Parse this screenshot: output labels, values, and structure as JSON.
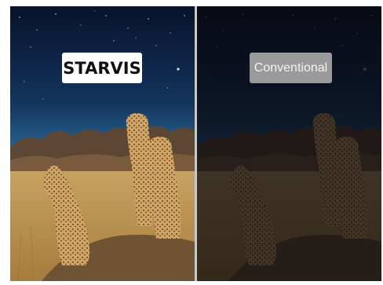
{
  "comparison": {
    "left_label": "STARVIS",
    "right_label": "Conventional"
  },
  "colors": {
    "sky_top": "#0b1530",
    "sky_horizon": "#2f6d9c",
    "grass": "#b98f4c",
    "cheetah": "#c99a5a",
    "label_starvis_bg": "#ffffff",
    "label_conventional_bg": "#9a9a9a"
  },
  "icons": {
    "scene": "cheetahs-night-scene"
  }
}
